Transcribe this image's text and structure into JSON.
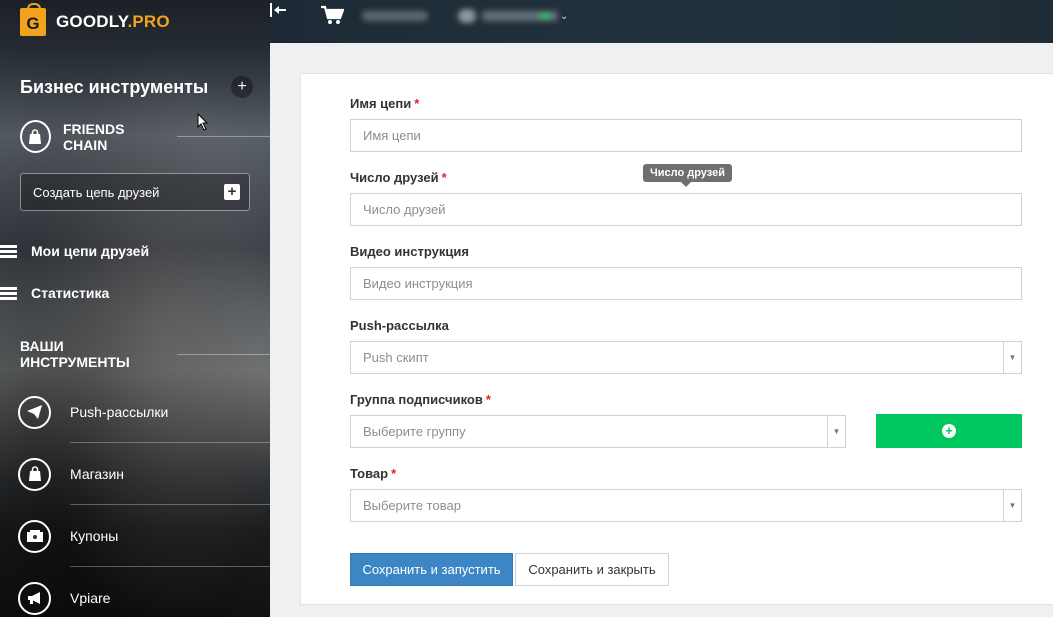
{
  "brand": {
    "name_main": "GOODLY",
    "name_suffix": ".PRO",
    "logo_letter": "G"
  },
  "sidebar": {
    "section_title": "Бизнес инструменты",
    "add_label": "+",
    "friends_chain": {
      "title": "FRIENDS CHAIN",
      "icon": "shopping-bag-icon"
    },
    "create_chain_label": "Создать цепь друзей",
    "create_chain_plus": "+",
    "links": [
      {
        "label": "Мои цепи друзей",
        "icon": "list-icon"
      },
      {
        "label": "Статистика",
        "icon": "list-icon"
      }
    ],
    "tools_title": "ВАШИ ИНСТРУМЕНТЫ",
    "tools": [
      {
        "label": "Push-рассылки",
        "icon": "paper-plane-icon"
      },
      {
        "label": "Магазин",
        "icon": "shopping-bag-icon"
      },
      {
        "label": "Купоны",
        "icon": "coupon-icon"
      },
      {
        "label": "Vpiare",
        "icon": "megaphone-icon"
      }
    ]
  },
  "topbar": {
    "collapse_icon": "collapse-left-icon",
    "cart_icon": "cart-icon"
  },
  "form": {
    "fields": [
      {
        "label": "Имя цепи",
        "required": "*",
        "placeholder": "Имя цепи"
      },
      {
        "label": "Число друзей",
        "required": "*",
        "placeholder": "Число друзей"
      },
      {
        "label": "Видео инструкция",
        "required": "",
        "placeholder": "Видео инструкция"
      },
      {
        "label": "Push-рассылка",
        "required": "",
        "placeholder": "Push скипт"
      },
      {
        "label": "Группа подписчиков",
        "required": "*",
        "placeholder": "Выберите группу"
      },
      {
        "label": "Товар",
        "required": "*",
        "placeholder": "Выберите товар"
      }
    ],
    "tooltip": "Число друзей",
    "add_group_icon": "plus-circle-icon",
    "save_run_label": "Сохранить и запустить",
    "save_close_label": "Сохранить и закрыть"
  },
  "colors": {
    "accent_orange": "#f2a31b",
    "primary_blue": "#3d86c6",
    "success_green": "#00c85f",
    "required_red": "#d9242b"
  }
}
